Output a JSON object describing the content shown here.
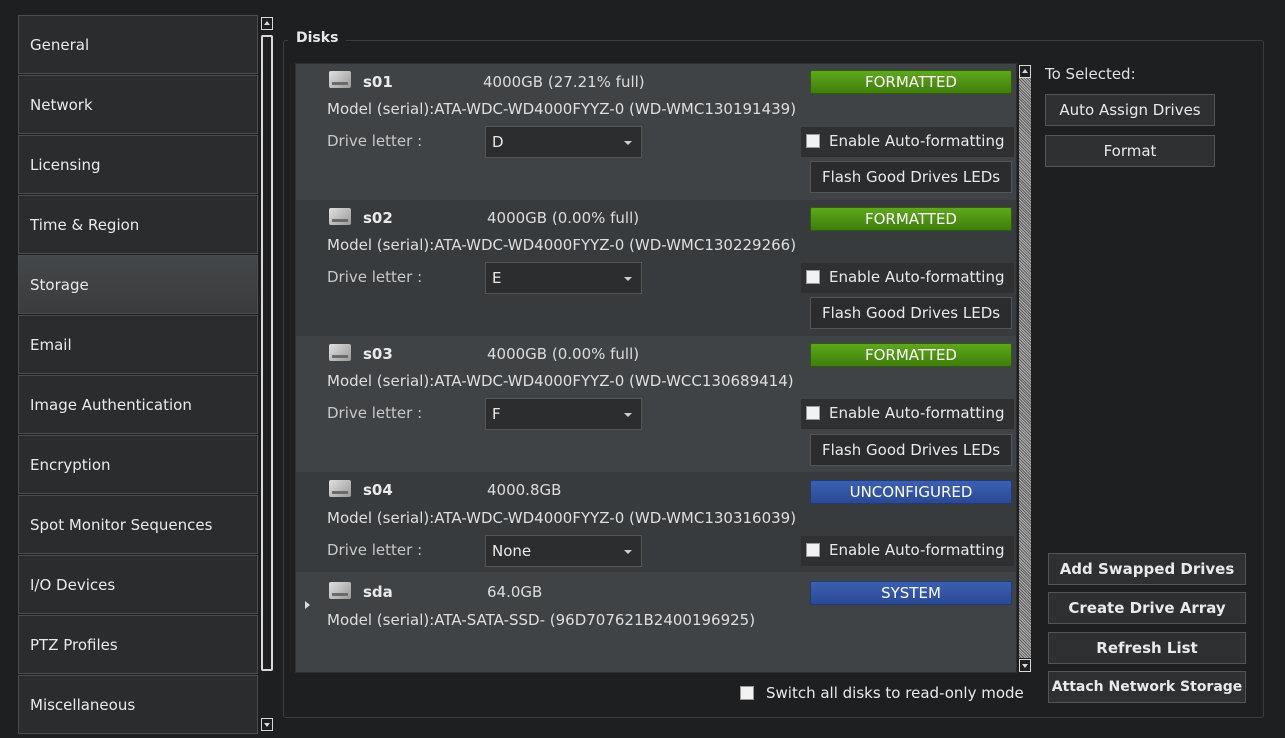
{
  "sidebar": {
    "items": [
      {
        "label": "General"
      },
      {
        "label": "Network"
      },
      {
        "label": "Licensing"
      },
      {
        "label": "Time & Region"
      },
      {
        "label": "Storage",
        "selected": true
      },
      {
        "label": "Email"
      },
      {
        "label": "Image Authentication"
      },
      {
        "label": "Encryption"
      },
      {
        "label": "Spot Monitor Sequences"
      },
      {
        "label": "I/O Devices"
      },
      {
        "label": "PTZ Profiles"
      },
      {
        "label": "Miscellaneous"
      }
    ]
  },
  "disks": {
    "title": "Disks",
    "drive_letter_label": "Drive letter :",
    "auto_format_label": "Enable Auto-formatting",
    "flash_label": "Flash Good Drives LEDs",
    "items": [
      {
        "name": "s01",
        "size": "4000GB (27.21% full)",
        "status": "FORMATTED",
        "model": "Model (serial):ATA-WDC-WD4000FYYZ-0 (WD-WMC130191439)",
        "drive_letter": "D"
      },
      {
        "name": "s02",
        "size": "4000GB (0.00% full)",
        "status": "FORMATTED",
        "model": "Model (serial):ATA-WDC-WD4000FYYZ-0 (WD-WMC130229266)",
        "drive_letter": "E"
      },
      {
        "name": "s03",
        "size": "4000GB (0.00% full)",
        "status": "FORMATTED",
        "model": "Model (serial):ATA-WDC-WD4000FYYZ-0 (WD-WCC130689414)",
        "drive_letter": "F"
      },
      {
        "name": "s04",
        "size": "4000.8GB",
        "status": "UNCONFIGURED",
        "model": "Model (serial):ATA-WDC-WD4000FYYZ-0 (WD-WMC130316039)",
        "drive_letter": "None"
      },
      {
        "name": "sda",
        "size": "64.0GB",
        "status": "SYSTEM",
        "model": "Model (serial):ATA-SATA-SSD- (96D707621B2400196925)"
      }
    ],
    "read_only_label": "Switch all disks to read-only mode"
  },
  "actions": {
    "to_selected": "To Selected:",
    "auto_assign": "Auto Assign Drives",
    "format": "Format",
    "add_swapped": "Add Swapped Drives",
    "create_array": "Create Drive Array",
    "refresh": "Refresh List",
    "attach_network": "Attach Network Storage"
  },
  "colors": {
    "formatted": "#4f9616",
    "unconfigured": "#3456a8",
    "system": "#3456a8"
  }
}
